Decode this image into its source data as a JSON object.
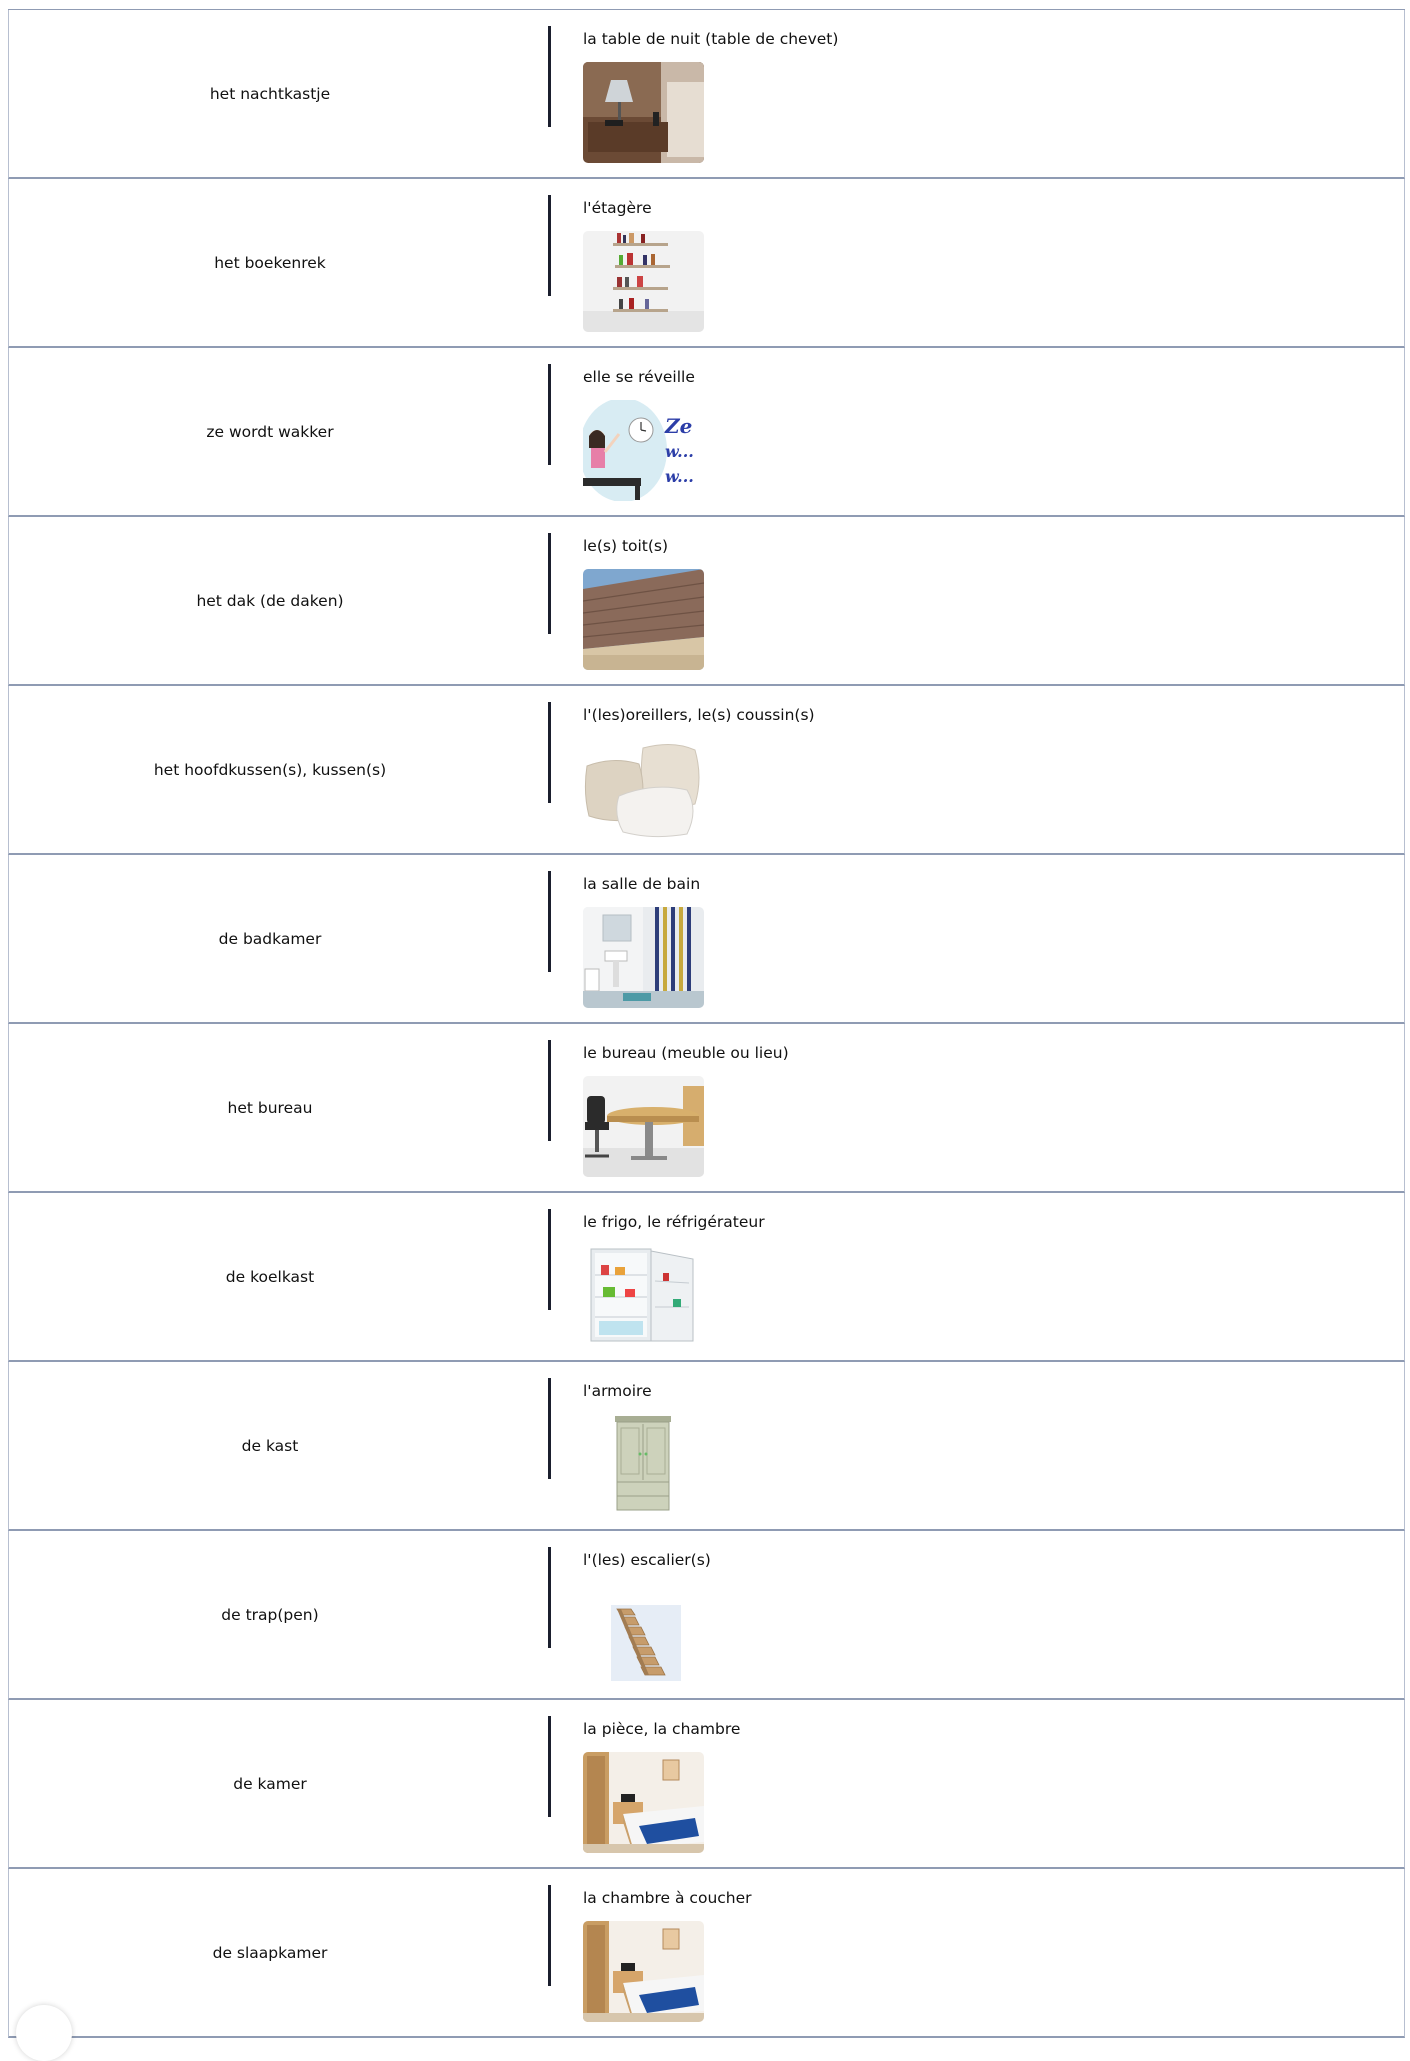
{
  "flashcards": [
    {
      "term": "het nachtkastje",
      "definition": "la table de nuit (table de chevet)",
      "image_icon": "nightstand-image"
    },
    {
      "term": "het boekenrek",
      "definition": "l'étagère",
      "image_icon": "bookshelf-image"
    },
    {
      "term": "ze wordt wakker",
      "definition": "elle se réveille",
      "image_icon": "wake-up-image",
      "image_caption_lines": [
        "Ze",
        "w...",
        "w..."
      ]
    },
    {
      "term": "het dak (de daken)",
      "definition": "le(s) toit(s)",
      "image_icon": "roof-image"
    },
    {
      "term": "het hoofdkussen(s), kussen(s)",
      "definition": "l'(les)oreillers, le(s) coussin(s)",
      "image_icon": "pillows-image"
    },
    {
      "term": "de badkamer",
      "definition": "la salle de bain",
      "image_icon": "bathroom-image"
    },
    {
      "term": "het bureau",
      "definition": "le bureau (meuble ou lieu)",
      "image_icon": "desk-image"
    },
    {
      "term": "de koelkast",
      "definition": "le frigo, le réfrigérateur",
      "image_icon": "fridge-image"
    },
    {
      "term": "de kast",
      "definition": "l'armoire",
      "image_icon": "wardrobe-image"
    },
    {
      "term": "de trap(pen)",
      "definition": "l'(les) escalier(s)",
      "image_icon": "stairs-image"
    },
    {
      "term": "de kamer",
      "definition": "la pièce, la chambre",
      "image_icon": "room-image"
    },
    {
      "term": "de slaapkamer",
      "definition": "la chambre à coucher",
      "image_icon": "bedroom-image"
    }
  ],
  "colors": {
    "row_border": "#8f9bb3",
    "divider": "#1b1f2e",
    "text": "#111111",
    "background": "#ffffff"
  }
}
